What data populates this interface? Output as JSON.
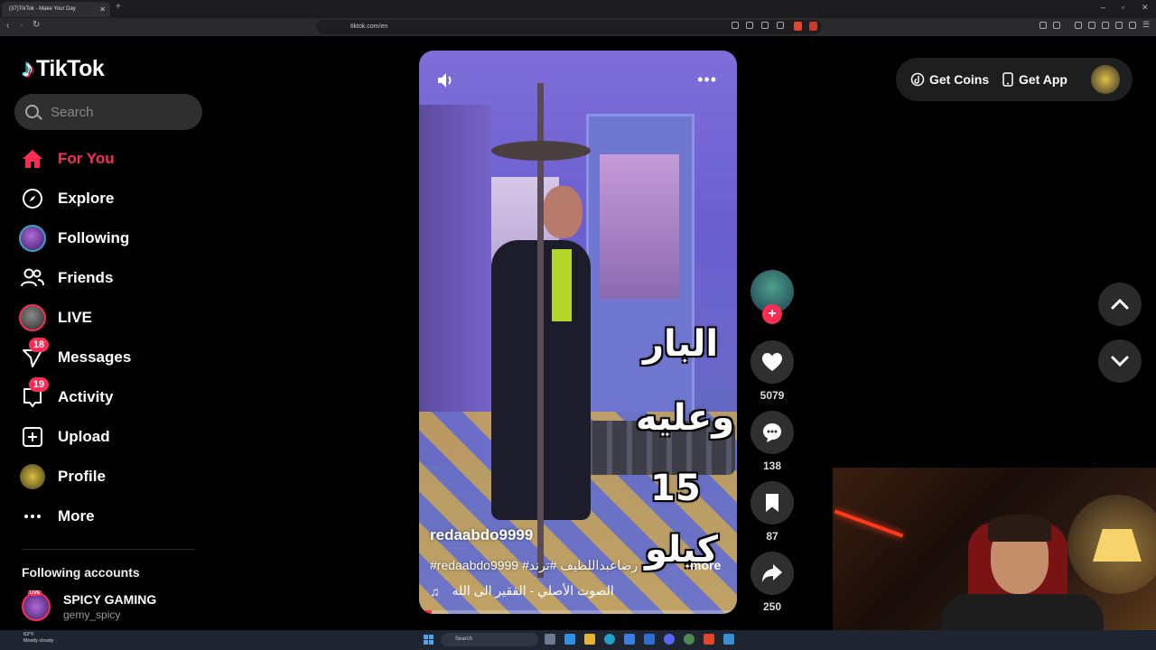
{
  "browser": {
    "tab_title": "(37)TikTok - Make Your Day",
    "url": "tiktok.com/en"
  },
  "sidebar": {
    "logo": "TikTok",
    "search_placeholder": "Search",
    "items": [
      {
        "label": "For You",
        "icon": "home-icon",
        "active": true
      },
      {
        "label": "Explore",
        "icon": "compass-icon"
      },
      {
        "label": "Following",
        "icon": "following-avatar-icon"
      },
      {
        "label": "Friends",
        "icon": "friends-icon"
      },
      {
        "label": "LIVE",
        "icon": "live-avatar-icon"
      },
      {
        "label": "Messages",
        "icon": "send-icon",
        "badge": "18"
      },
      {
        "label": "Activity",
        "icon": "inbox-icon",
        "badge": "19"
      },
      {
        "label": "Upload",
        "icon": "plus-square-icon"
      },
      {
        "label": "Profile",
        "icon": "profile-avatar-icon"
      },
      {
        "label": "More",
        "icon": "ellipsis-icon"
      }
    ],
    "following_title": "Following accounts",
    "accounts": [
      {
        "name": "SPICY GAMING",
        "handle": "gemy_spicy",
        "live": "LIVE"
      }
    ]
  },
  "header": {
    "get_coins": "Get Coins",
    "get_app": "Get App"
  },
  "video": {
    "author": "redaabdo9999",
    "caption": "#redaabdo9999 #رضاعبداللطيف #ترند",
    "more": "more",
    "music": "الصوت الأصلي - الفقير الى الله",
    "overlay": [
      "البار",
      "وعليه",
      "15",
      "كيلو"
    ],
    "progress": 0.04
  },
  "actions": {
    "likes": "5079",
    "comments": "138",
    "saves": "87",
    "shares": "250"
  },
  "taskbar": {
    "temp": "63°F",
    "weather": "Mostly cloudy",
    "search": "Search"
  },
  "colors": {
    "accent": "#fe2c55",
    "background": "#000000",
    "surface": "#2f2f2f"
  }
}
